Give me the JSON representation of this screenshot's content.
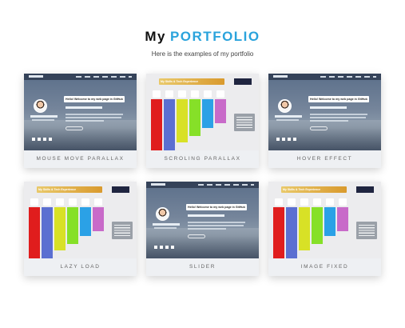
{
  "header": {
    "title_prefix": "My",
    "title_main": "PORTFOLIO",
    "subtitle": "Here is the examples of my portfolio"
  },
  "colors": {
    "accent": "#2aa3dc",
    "caption_bg": "#eef0f3",
    "skill_bars": [
      "#e01d1d",
      "#5b6fd1",
      "#d8e126",
      "#86e028",
      "#2ba1e6",
      "#c86ac9",
      "#ffffff"
    ]
  },
  "cards": [
    {
      "caption": "MOUSE MOVE PARALLAX",
      "preview": "hero"
    },
    {
      "caption": "SCROLING PARALLAX",
      "preview": "skills"
    },
    {
      "caption": "HOVER EFFECT",
      "preview": "hero"
    },
    {
      "caption": "LAZY LOAD",
      "preview": "skills"
    },
    {
      "caption": "SLIDER",
      "preview": "hero"
    },
    {
      "caption": "IMAGE FIXED",
      "preview": "skills"
    }
  ],
  "hero_preview": {
    "greeting": "Hello! Welcome to my web page in GitHub"
  },
  "skills_preview": {
    "banner": "My Skills & Tech Experience"
  }
}
